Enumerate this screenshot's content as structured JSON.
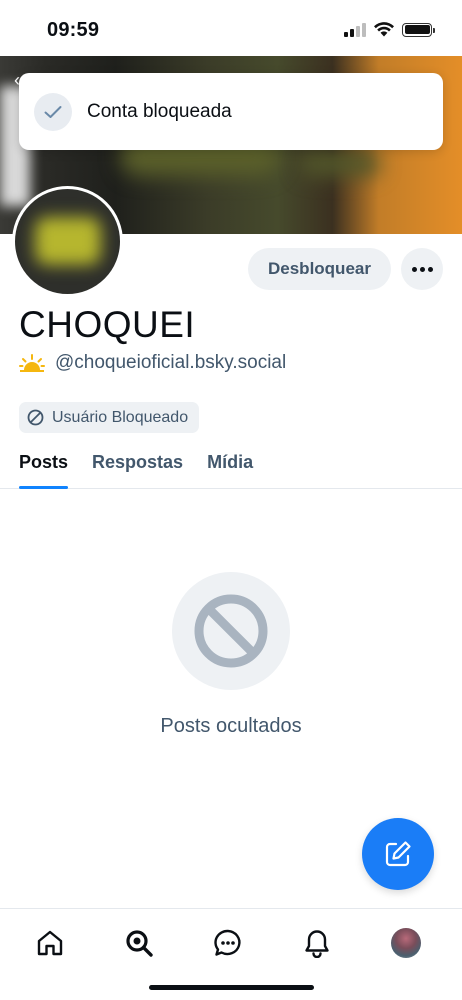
{
  "status_bar": {
    "time": "09:59"
  },
  "toast": {
    "message": "Conta bloqueada"
  },
  "profile": {
    "display_name": "CHOQUEI",
    "handle": "@choqueioficial.bsky.social",
    "unblock_label": "Desbloquear",
    "blocked_badge": "Usuário Bloqueado"
  },
  "tabs": [
    {
      "label": "Posts",
      "active": true
    },
    {
      "label": "Respostas",
      "active": false
    },
    {
      "label": "Mídia",
      "active": false
    }
  ],
  "empty_state": {
    "message": "Posts ocultados"
  },
  "nav": {
    "items": [
      "home-icon",
      "search-icon",
      "chat-icon",
      "bell-icon",
      "profile-avatar"
    ]
  },
  "colors": {
    "accent": "#1083fe",
    "fab": "#1a7df7",
    "muted_text": "#42576c",
    "button_bg": "#eef1f4"
  }
}
